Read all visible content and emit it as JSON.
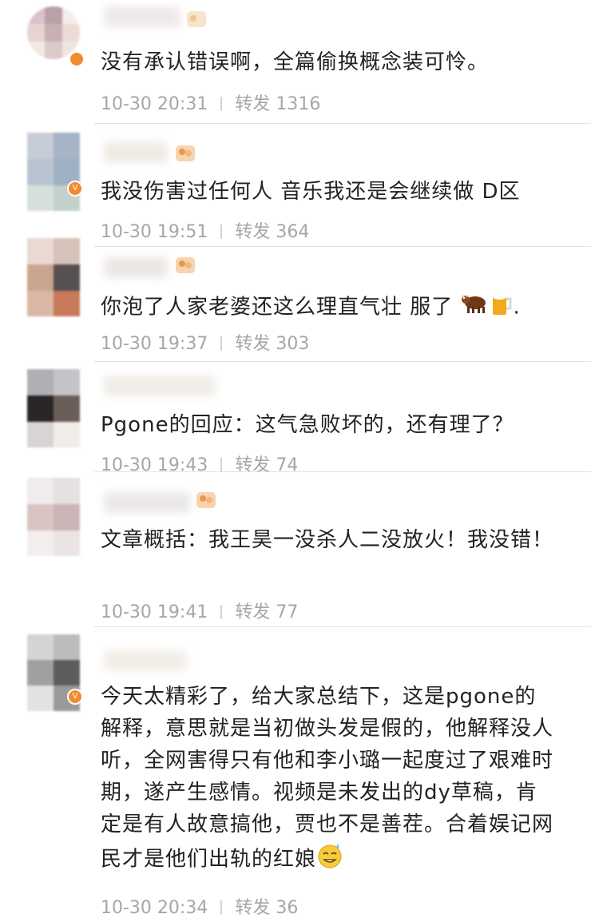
{
  "comments": [
    {
      "text": "没有承认错误啊，全篇偷换概念装可怜。",
      "time": "10-30 20:31",
      "repost_label": "转发",
      "repost_count": "1316"
    },
    {
      "text": "我没伤害过任何人  音乐我还是会继续做 D区",
      "time": "10-30 19:51",
      "repost_label": "转发",
      "repost_count": "364"
    },
    {
      "text": "你泡了人家老婆还这么理直气壮 服了",
      "text_tail": ".",
      "emojis": [
        "cow-emoji",
        "beer-emoji"
      ],
      "time": "10-30 19:37",
      "repost_label": "转发",
      "repost_count": "303"
    },
    {
      "text": "Pgone的回应：这气急败坏的，还有理了？",
      "time": "10-30 19:43",
      "repost_label": "转发",
      "repost_count": "74"
    },
    {
      "text": "文章概括：我王昊一没杀人二没放火！我没错！",
      "time": "10-30 19:41",
      "repost_label": "转发",
      "repost_count": "77"
    },
    {
      "text": "今天太精彩了，给大家总结下，这是pgone的解释，意思就是当初做头发是假的，他解释没人听，全网害得只有他和李小璐一起度过了艰难时期，遂产生感情。视频是未发出的dy草稿，肯定是有人故意搞他，贾也不是善茬。合着娱记网民才是他们出轨的红娘",
      "emojis": [
        "sweat-smile-emoji"
      ],
      "time": "10-30 20:34",
      "repost_label": "转发",
      "repost_count": "36"
    }
  ],
  "colors": {
    "text": "#222222",
    "meta": "#a6a6a6",
    "divider": "#e2e2e2",
    "verified_badge": "#f28a2e"
  }
}
